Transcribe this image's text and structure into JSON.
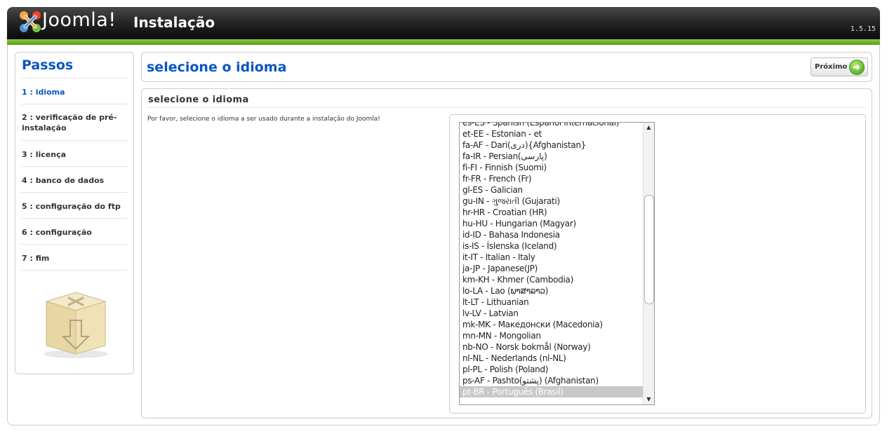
{
  "header": {
    "logo_text": "Joomla!",
    "title": "Instalação",
    "version": "1.5.15"
  },
  "sidebar": {
    "title": "Passos",
    "steps": [
      {
        "label": "1 : idioma",
        "active": true
      },
      {
        "label": "2 : verificação de pré-instalação",
        "active": false
      },
      {
        "label": "3 : licença",
        "active": false
      },
      {
        "label": "4 : banco de dados",
        "active": false
      },
      {
        "label": "5 : configuração do ftp",
        "active": false
      },
      {
        "label": "6 : configuração",
        "active": false
      },
      {
        "label": "7 : fim",
        "active": false
      }
    ],
    "illustration_icon": "joomla-install-box-icon"
  },
  "main": {
    "header_title": "selecione o idioma",
    "next_button": {
      "label": "Próximo",
      "icon": "arrow-right-circle-icon"
    },
    "section_title": "selecione o idioma",
    "instructions": "Por favor, selecione o idioma a ser usado durante a instalação do Joomla!",
    "languages": [
      "es-ES - Spanish (Español internacional)",
      "et-EE - Estonian - et",
      "fa-AF - Dari(دری){Afghanistan}",
      "fa-IR - Persian(پارسی)",
      "fi-FI - Finnish (Suomi)",
      "fr-FR - French (Fr)",
      "gl-ES - Galician",
      "gu-IN - ગુજરાતી (Gujarati)",
      "hr-HR - Croatian (HR)",
      "hu-HU - Hungarian (Magyar)",
      "id-ID - Bahasa Indonesia",
      "is-IS - Íslenska (Iceland)",
      "it-IT - Italian - Italy",
      "ja-JP - Japanese(JP)",
      "km-KH - Khmer (Cambodia)",
      "lo-LA - Lao (ພາສາລາວ)",
      "lt-LT - Lithuanian",
      "lv-LV - Latvian",
      "mk-MK - Македонски (Macedonia)",
      "mn-MN - Mongolian",
      "nb-NO - Norsk bokmål (Norway)",
      "nl-NL - Nederlands (nl-NL)",
      "pl-PL - Polish (Poland)",
      "ps-AF - Pashto(پشتو) (Afghanistan)",
      "pt-BR - Português (Brasil)"
    ],
    "selected_language": "pt-BR - Português (Brasil)"
  },
  "colors": {
    "accent_blue": "#0b55c4",
    "header_green": "#7ab62f",
    "header_dark": "#1a1a1a"
  }
}
